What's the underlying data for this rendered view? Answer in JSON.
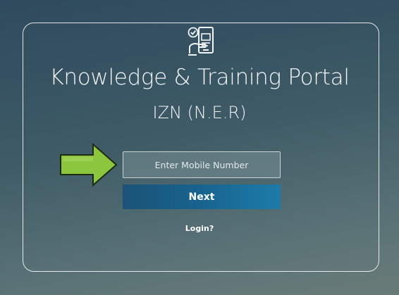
{
  "portal": {
    "title": "Knowledge & Training Portal",
    "subtitle": "IZN (N.E.R)"
  },
  "form": {
    "mobile_placeholder": "Enter Mobile Number",
    "next_label": "Next",
    "login_link": "Login?"
  },
  "icons": {
    "logo": "mobile-verified-icon",
    "annotation": "green-arrow-icon"
  },
  "colors": {
    "button": "#17648f",
    "arrow_fill": "#8cc63f",
    "frame_border": "#ffffff"
  }
}
